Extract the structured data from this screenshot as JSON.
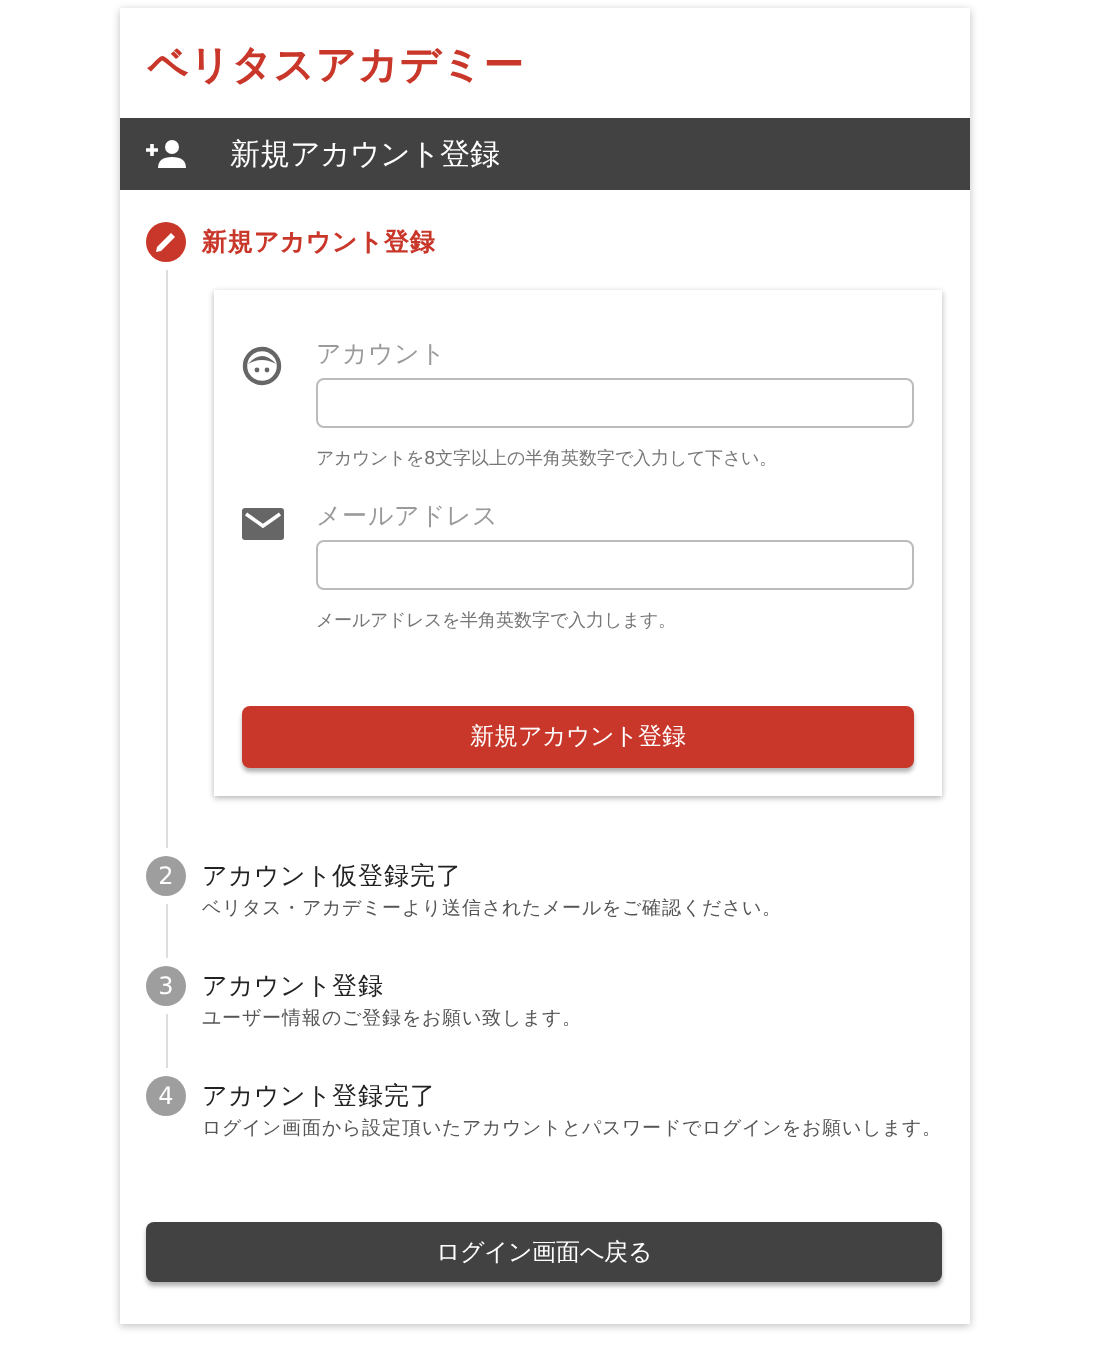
{
  "logo": "ベリタスアカデミー",
  "header": {
    "title": "新規アカウント登録"
  },
  "steps": [
    {
      "title": "新規アカウント登録",
      "active": true,
      "form": {
        "fields": [
          {
            "kind": "account",
            "label": "アカウント",
            "hint": "アカウントを8文字以上の半角英数字で入力して下さい。"
          },
          {
            "kind": "email",
            "label": "メールアドレス",
            "hint": "メールアドレスを半角英数字で入力します。"
          }
        ],
        "submit": "新規アカウント登録"
      }
    },
    {
      "number": "2",
      "title": "アカウント仮登録完了",
      "description": "ベリタス・アカデミーより送信されたメールをご確認ください。",
      "active": false
    },
    {
      "number": "3",
      "title": "アカウント登録",
      "description": "ユーザー情報のご登録をお願い致します。",
      "active": false
    },
    {
      "number": "4",
      "title": "アカウント登録完了",
      "description": "ログイン画面から設定頂いたアカウントとパスワードでログインをお願いします。",
      "active": false
    }
  ],
  "back_button": "ログイン画面へ戻る"
}
